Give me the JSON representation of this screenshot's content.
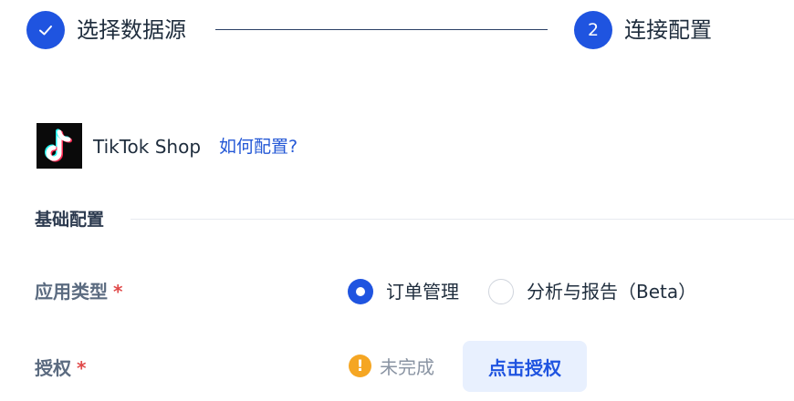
{
  "stepper": {
    "steps": [
      {
        "label": "选择数据源",
        "state": "done",
        "icon": "check-icon"
      },
      {
        "label": "连接配置",
        "state": "current",
        "number": "2"
      }
    ]
  },
  "platform": {
    "name": "TikTok Shop",
    "logo_icon": "tiktok-logo",
    "help_link": "如何配置?"
  },
  "section": {
    "title": "基础配置"
  },
  "form": {
    "app_type": {
      "label": "应用类型",
      "required_mark": "*",
      "options": [
        {
          "label": "订单管理",
          "selected": true
        },
        {
          "label": "分析与报告（Beta）",
          "selected": false
        }
      ]
    },
    "authorization": {
      "label": "授权",
      "required_mark": "*",
      "status_icon": "warning-icon",
      "status_text": "未完成",
      "button_label": "点击授权"
    }
  },
  "colors": {
    "primary": "#1f54e0",
    "link": "#2458d6",
    "required": "#e04a4a",
    "warning": "#f5a623",
    "button_bg": "#e8f0fe"
  }
}
